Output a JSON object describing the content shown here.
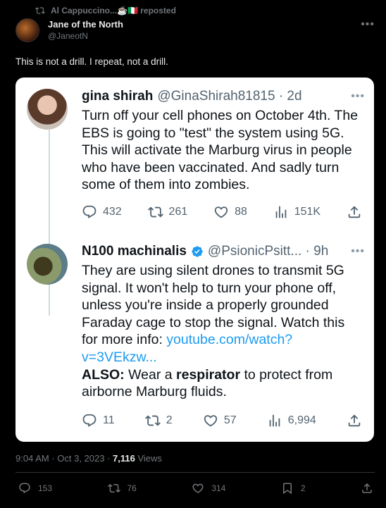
{
  "repost": {
    "label": "Al Cappuccino...☕🇮🇹 reposted",
    "icon": "repost-icon"
  },
  "author": {
    "name": "Jane of the North",
    "handle": "@JaneotN"
  },
  "tweet": {
    "text": "This is not a drill. I repeat, not a drill."
  },
  "quote": {
    "posts": [
      {
        "name": "gina shirah",
        "handle": "@GinaShirah81815 · 2d",
        "body": "Turn off your cell phones on October 4th. The EBS is going to \"test\" the system using 5G. This will activate the Marburg virus in people who have been vaccinated. And sadly turn some of them into zombies.",
        "replies": "432",
        "reposts": "261",
        "likes": "88",
        "views": "151K"
      },
      {
        "name": "N100 machinalis",
        "handle": "@PsionicPsitt... · 9h",
        "body_part1": "They are using silent drones to transmit 5G signal. It won't help to turn your phone off, unless you're inside a properly grounded Faraday cage to stop the signal. Watch this for more info: ",
        "link": "youtube.com/watch?v=3VEkzw...",
        "also_label": "ALSO:",
        "body_part2": " Wear a ",
        "bold_word": "respirator",
        "body_part3": " to protect from airborne Marburg fluids.",
        "replies": "11",
        "reposts": "2",
        "likes": "57",
        "views": "6,994"
      }
    ]
  },
  "meta": {
    "time": "9:04 AM · Oct 3, 2023 · ",
    "views_count": "7,116",
    "views_label": " Views"
  },
  "actions": {
    "replies": "153",
    "reposts": "76",
    "likes": "314",
    "bookmarks": "2"
  },
  "colors": {
    "link": "#1d9bf0",
    "muted": "#71767b",
    "background": "#000000",
    "card": "#ffffff"
  }
}
